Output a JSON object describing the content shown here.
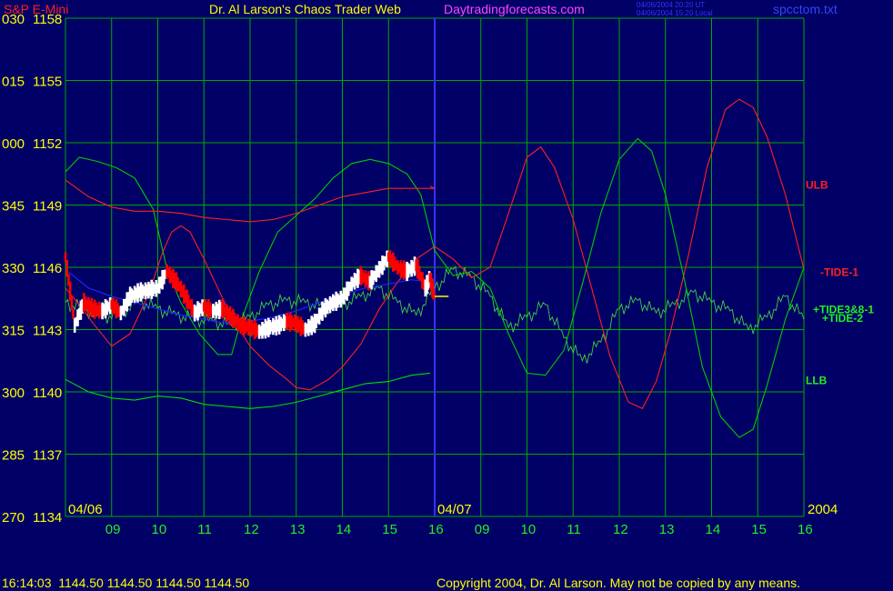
{
  "header": {
    "symbol": "S&P E-Mini",
    "title": "Dr. Al Larson's Chaos Trader Web",
    "website": "Daytradingforecasts.com",
    "stamp1": "04/06/2004 20:20 UT",
    "stamp2": "04/06/2004 15:20 Local",
    "file": "spcctom.txt"
  },
  "footer": {
    "quote": "16:14:03  1144.50 1144.50 1144.50 1144.50",
    "copyright": "Copyright 2004, Dr. Al Larson. May not be copied by any means."
  },
  "colors": {
    "background": "#000066",
    "grid": "#00aa00",
    "axis_text": "#ffff00",
    "upper_band": "#ff2020",
    "lower_band": "#00dd00",
    "moving_average": "#2222ff",
    "price_up": "#ffffff",
    "price_down": "#ff0000",
    "signal": "#ffff00",
    "tide1": "#ff2020",
    "tide2": "#00cc00",
    "tide_composite": "#44cc44",
    "divider": "#3333ff"
  },
  "chart_data": {
    "type": "line",
    "y_labels": [
      {
        "angle": "030",
        "price": "1158",
        "value": 1158
      },
      {
        "angle": "015",
        "price": "1155",
        "value": 1155
      },
      {
        "angle": "000",
        "price": "1152",
        "value": 1152
      },
      {
        "angle": "345",
        "price": "1149",
        "value": 1149
      },
      {
        "angle": "330",
        "price": "1146",
        "value": 1146
      },
      {
        "angle": "315",
        "price": "1143",
        "value": 1143
      },
      {
        "angle": "300",
        "price": "1140",
        "value": 1140
      },
      {
        "angle": "285",
        "price": "1137",
        "value": 1137
      },
      {
        "angle": "270",
        "price": "1134",
        "value": 1134
      }
    ],
    "ylim": [
      1134,
      1158
    ],
    "x_hours": [
      "09",
      "10",
      "11",
      "12",
      "13",
      "14",
      "15",
      "16",
      "09",
      "10",
      "11",
      "12",
      "13",
      "14",
      "15",
      "16"
    ],
    "x_index_range": [
      0,
      16
    ],
    "date_labels": [
      {
        "text": "04/06",
        "at": 0
      },
      {
        "text": "04/07",
        "at": 8
      }
    ],
    "year": "2004",
    "divider_at": 8,
    "grid": true,
    "series_labels": [
      {
        "text": "ULB",
        "color": "#ff2020",
        "y": 1150
      },
      {
        "text": "-TIDE-1",
        "color": "#ff2020",
        "y": 1145.8
      },
      {
        "text": "+TIDE3&8-1",
        "color": "#22ee22",
        "y": 1144
      },
      {
        "text": "+TIDE-2",
        "color": "#22ee22",
        "y": 1143.6
      },
      {
        "text": "LLB",
        "color": "#22ee22",
        "y": 1140.6
      }
    ],
    "upper_band": [
      [
        0,
        1150.2
      ],
      [
        0.5,
        1149.4
      ],
      [
        1,
        1148.9
      ],
      [
        1.5,
        1148.7
      ],
      [
        2,
        1148.7
      ],
      [
        2.5,
        1148.6
      ],
      [
        3,
        1148.4
      ],
      [
        3.5,
        1148.3
      ],
      [
        4,
        1148.2
      ],
      [
        4.5,
        1148.3
      ],
      [
        5,
        1148.6
      ],
      [
        5.5,
        1149.0
      ],
      [
        6,
        1149.4
      ],
      [
        6.5,
        1149.6
      ],
      [
        7,
        1149.8
      ],
      [
        7.5,
        1149.8
      ],
      [
        8,
        1149.8
      ],
      [
        7.9,
        1149.9
      ]
    ],
    "lower_band": [
      [
        0,
        1140.6
      ],
      [
        0.5,
        1140.0
      ],
      [
        1,
        1139.7
      ],
      [
        1.5,
        1139.6
      ],
      [
        2,
        1139.8
      ],
      [
        2.5,
        1139.7
      ],
      [
        3,
        1139.4
      ],
      [
        3.5,
        1139.3
      ],
      [
        4,
        1139.2
      ],
      [
        4.5,
        1139.3
      ],
      [
        5,
        1139.5
      ],
      [
        5.5,
        1139.8
      ],
      [
        6,
        1140.1
      ],
      [
        6.5,
        1140.4
      ],
      [
        7,
        1140.5
      ],
      [
        7.5,
        1140.8
      ],
      [
        7.9,
        1140.9
      ]
    ],
    "moving_average": [
      [
        0,
        1145.9
      ],
      [
        0.5,
        1145.0
      ],
      [
        1,
        1144.6
      ],
      [
        1.5,
        1144.3
      ],
      [
        2,
        1144.0
      ],
      [
        2.5,
        1143.7
      ],
      [
        3,
        1143.5
      ],
      [
        3.5,
        1143.3
      ],
      [
        4,
        1143.4
      ],
      [
        4.5,
        1143.6
      ],
      [
        5,
        1143.9
      ],
      [
        5.5,
        1144.3
      ],
      [
        6,
        1144.7
      ],
      [
        6.5,
        1145.0
      ],
      [
        7,
        1145.2
      ],
      [
        7.5,
        1145.4
      ],
      [
        7.9,
        1145.3
      ]
    ],
    "price": [
      [
        0,
        1146.5
      ],
      [
        0.2,
        1143.2
      ],
      [
        0.4,
        1144.3
      ],
      [
        0.6,
        1144.0
      ],
      [
        0.8,
        1143.9
      ],
      [
        1,
        1144.2
      ],
      [
        1.2,
        1143.8
      ],
      [
        1.4,
        1144.6
      ],
      [
        1.6,
        1144.8
      ],
      [
        1.8,
        1144.9
      ],
      [
        2,
        1145.0
      ],
      [
        2.2,
        1145.8
      ],
      [
        2.4,
        1145.3
      ],
      [
        2.6,
        1144.6
      ],
      [
        2.8,
        1143.8
      ],
      [
        3,
        1144.1
      ],
      [
        3.2,
        1143.9
      ],
      [
        3.4,
        1144.0
      ],
      [
        3.6,
        1143.6
      ],
      [
        3.8,
        1143.2
      ],
      [
        4,
        1143.1
      ],
      [
        4.2,
        1142.9
      ],
      [
        4.4,
        1143.1
      ],
      [
        4.6,
        1143.2
      ],
      [
        4.8,
        1143.4
      ],
      [
        5,
        1143.3
      ],
      [
        5.2,
        1143.0
      ],
      [
        5.4,
        1143.3
      ],
      [
        5.6,
        1144.0
      ],
      [
        5.8,
        1144.3
      ],
      [
        6,
        1144.5
      ],
      [
        6.2,
        1145.2
      ],
      [
        6.4,
        1145.6
      ],
      [
        6.6,
        1145.3
      ],
      [
        6.8,
        1145.9
      ],
      [
        7,
        1146.5
      ],
      [
        7.2,
        1146.0
      ],
      [
        7.4,
        1145.8
      ],
      [
        7.6,
        1146.1
      ],
      [
        7.8,
        1145.0
      ],
      [
        7.9,
        1145.5
      ],
      [
        8,
        1144.5
      ]
    ],
    "tide1": [
      [
        0,
        1145.0
      ],
      [
        0.3,
        1144.2
      ],
      [
        0.6,
        1143.3
      ],
      [
        1,
        1142.2
      ],
      [
        1.4,
        1142.8
      ],
      [
        1.8,
        1144.7
      ],
      [
        2.1,
        1146.7
      ],
      [
        2.3,
        1147.7
      ],
      [
        2.5,
        1148.0
      ],
      [
        2.7,
        1147.7
      ],
      [
        3,
        1146.4
      ],
      [
        3.3,
        1145.0
      ],
      [
        3.6,
        1143.6
      ],
      [
        4,
        1142.2
      ],
      [
        4.4,
        1141.3
      ],
      [
        4.8,
        1140.6
      ],
      [
        5,
        1140.2
      ],
      [
        5.3,
        1140.1
      ],
      [
        5.7,
        1140.6
      ],
      [
        6,
        1141.2
      ],
      [
        6.4,
        1142.3
      ],
      [
        6.8,
        1144.0
      ],
      [
        7.2,
        1145.3
      ],
      [
        7.6,
        1146.4
      ],
      [
        8,
        1147.0
      ],
      [
        8.4,
        1146.4
      ],
      [
        8.8,
        1145.5
      ],
      [
        9.2,
        1146.0
      ],
      [
        9.6,
        1148.6
      ],
      [
        10,
        1151.3
      ],
      [
        10.3,
        1151.8
      ],
      [
        10.6,
        1150.8
      ],
      [
        11,
        1148.3
      ],
      [
        11.4,
        1145.0
      ],
      [
        11.8,
        1141.7
      ],
      [
        12.2,
        1139.5
      ],
      [
        12.5,
        1139.2
      ],
      [
        12.8,
        1140.5
      ],
      [
        13.1,
        1142.8
      ],
      [
        13.5,
        1146.6
      ],
      [
        13.9,
        1150.8
      ],
      [
        14.3,
        1153.6
      ],
      [
        14.6,
        1154.1
      ],
      [
        14.9,
        1153.7
      ],
      [
        15.2,
        1152.3
      ],
      [
        15.6,
        1149.5
      ],
      [
        16,
        1145.9
      ]
    ],
    "tide2": [
      [
        0,
        1150.6
      ],
      [
        0.3,
        1151.3
      ],
      [
        0.7,
        1151.1
      ],
      [
        1.1,
        1150.8
      ],
      [
        1.5,
        1150.3
      ],
      [
        1.9,
        1148.8
      ],
      [
        2.2,
        1145.9
      ],
      [
        2.5,
        1144.3
      ],
      [
        2.9,
        1142.8
      ],
      [
        3.3,
        1141.8
      ],
      [
        3.6,
        1141.8
      ],
      [
        3.8,
        1143.4
      ],
      [
        4.2,
        1145.8
      ],
      [
        4.6,
        1147.7
      ],
      [
        5,
        1148.5
      ],
      [
        5.4,
        1149.3
      ],
      [
        5.8,
        1150.3
      ],
      [
        6.2,
        1151.0
      ],
      [
        6.6,
        1151.2
      ],
      [
        7,
        1151.0
      ],
      [
        7.4,
        1150.5
      ],
      [
        7.7,
        1149.5
      ],
      [
        8,
        1146.8
      ],
      [
        8.4,
        1145.6
      ],
      [
        8.8,
        1145.8
      ],
      [
        9.2,
        1145.0
      ],
      [
        9.6,
        1142.8
      ],
      [
        10,
        1140.9
      ],
      [
        10.4,
        1140.8
      ],
      [
        10.8,
        1142.0
      ],
      [
        11.2,
        1145.2
      ],
      [
        11.6,
        1148.6
      ],
      [
        12,
        1151.2
      ],
      [
        12.4,
        1152.2
      ],
      [
        12.7,
        1151.6
      ],
      [
        13,
        1149.5
      ],
      [
        13.4,
        1145.5
      ],
      [
        13.8,
        1141.2
      ],
      [
        14.2,
        1138.8
      ],
      [
        14.6,
        1137.8
      ],
      [
        14.9,
        1138.2
      ],
      [
        15.2,
        1140.3
      ],
      [
        15.6,
        1143.5
      ],
      [
        16,
        1146.0
      ]
    ],
    "tide_composite": [
      [
        0,
        1144.3
      ],
      [
        0.4,
        1144.0
      ],
      [
        0.8,
        1143.6
      ],
      [
        1.2,
        1143.8
      ],
      [
        1.6,
        1144.4
      ],
      [
        2,
        1144.0
      ],
      [
        2.4,
        1143.7
      ],
      [
        2.8,
        1143.5
      ],
      [
        3.2,
        1143.4
      ],
      [
        3.6,
        1143.2
      ],
      [
        4,
        1143.6
      ],
      [
        4.4,
        1144.2
      ],
      [
        4.8,
        1144.4
      ],
      [
        5.2,
        1144.3
      ],
      [
        5.6,
        1144.1
      ],
      [
        6,
        1144.2
      ],
      [
        6.4,
        1144.6
      ],
      [
        6.8,
        1145.0
      ],
      [
        7.2,
        1144.3
      ],
      [
        7.6,
        1143.7
      ],
      [
        8,
        1145.0
      ],
      [
        8.4,
        1145.9
      ],
      [
        8.8,
        1145.5
      ],
      [
        9.2,
        1144.6
      ],
      [
        9.6,
        1143.1
      ],
      [
        10,
        1143.6
      ],
      [
        10.4,
        1144.2
      ],
      [
        10.8,
        1142.6
      ],
      [
        11.2,
        1141.5
      ],
      [
        11.6,
        1142.4
      ],
      [
        12,
        1144.0
      ],
      [
        12.4,
        1144.4
      ],
      [
        12.8,
        1143.8
      ],
      [
        13.2,
        1144.2
      ],
      [
        13.6,
        1144.8
      ],
      [
        14,
        1144.3
      ],
      [
        14.4,
        1143.9
      ],
      [
        14.8,
        1143.0
      ],
      [
        15.2,
        1143.6
      ],
      [
        15.6,
        1144.6
      ],
      [
        16,
        1143.5
      ]
    ],
    "signal_marker": {
      "x": [
        8,
        8.3
      ],
      "y": 1144.6
    }
  }
}
